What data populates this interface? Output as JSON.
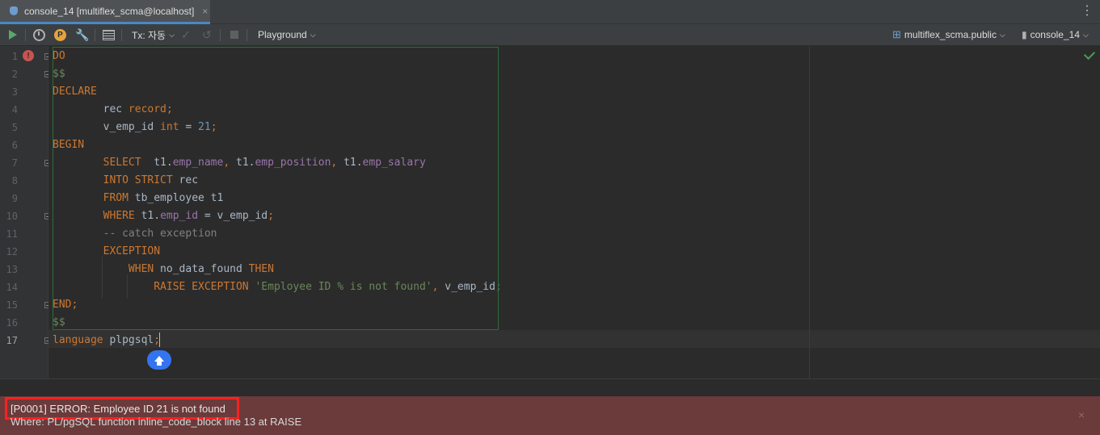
{
  "tab": {
    "title": "console_14 [multiflex_scma@localhost]",
    "close": "×"
  },
  "toolbar": {
    "tx_label": "Tx: 자동",
    "playground_label": "Playground",
    "schema_label": "multiflex_scma.public",
    "session_label": "console_14",
    "p_badge": "P"
  },
  "editor": {
    "lines": [
      {
        "n": "1",
        "tokens": [
          {
            "t": "DO",
            "c": "kw"
          }
        ]
      },
      {
        "n": "2",
        "tokens": [
          {
            "t": "$$",
            "c": "str"
          }
        ]
      },
      {
        "n": "3",
        "tokens": [
          {
            "t": "DECLARE",
            "c": "kw"
          }
        ]
      },
      {
        "n": "4",
        "tokens": [
          {
            "t": "        rec ",
            "c": "plain"
          },
          {
            "t": "record;",
            "c": "kw"
          }
        ]
      },
      {
        "n": "5",
        "tokens": [
          {
            "t": "        v_emp_id ",
            "c": "plain"
          },
          {
            "t": "int",
            "c": "kw"
          },
          {
            "t": " = ",
            "c": "plain"
          },
          {
            "t": "21",
            "c": "num"
          },
          {
            "t": ";",
            "c": "kw"
          }
        ]
      },
      {
        "n": "6",
        "tokens": [
          {
            "t": "BEGIN",
            "c": "kw"
          }
        ]
      },
      {
        "n": "7",
        "tokens": [
          {
            "t": "        SELECT",
            "c": "kw"
          },
          {
            "t": "  t1.",
            "c": "plain"
          },
          {
            "t": "emp_name",
            "c": "fld"
          },
          {
            "t": ", ",
            "c": "kw"
          },
          {
            "t": "t1.",
            "c": "plain"
          },
          {
            "t": "emp_position",
            "c": "fld"
          },
          {
            "t": ", ",
            "c": "kw"
          },
          {
            "t": "t1.",
            "c": "plain"
          },
          {
            "t": "emp_salary",
            "c": "fld"
          }
        ]
      },
      {
        "n": "8",
        "tokens": [
          {
            "t": "        INTO STRICT",
            "c": "kw"
          },
          {
            "t": " rec",
            "c": "plain"
          }
        ]
      },
      {
        "n": "9",
        "tokens": [
          {
            "t": "        FROM",
            "c": "kw"
          },
          {
            "t": " tb_employee t1",
            "c": "plain"
          }
        ]
      },
      {
        "n": "10",
        "tokens": [
          {
            "t": "        WHERE",
            "c": "kw"
          },
          {
            "t": " t1.",
            "c": "plain"
          },
          {
            "t": "emp_id",
            "c": "fld"
          },
          {
            "t": " = v_emp_id",
            "c": "plain"
          },
          {
            "t": ";",
            "c": "kw"
          }
        ]
      },
      {
        "n": "11",
        "tokens": [
          {
            "t": "        -- catch exception",
            "c": "cmt"
          }
        ]
      },
      {
        "n": "12",
        "tokens": [
          {
            "t": "        EXCEPTION",
            "c": "kw"
          }
        ]
      },
      {
        "n": "13",
        "tokens": [
          {
            "t": "            WHEN",
            "c": "kw"
          },
          {
            "t": " no_data_found ",
            "c": "plain"
          },
          {
            "t": "THEN",
            "c": "kw"
          }
        ]
      },
      {
        "n": "14",
        "tokens": [
          {
            "t": "                RAISE EXCEPTION",
            "c": "kw"
          },
          {
            "t": " ",
            "c": "plain"
          },
          {
            "t": "'Employee ID % is not found'",
            "c": "str"
          },
          {
            "t": ", ",
            "c": "kw"
          },
          {
            "t": "v_emp_id",
            "c": "plain"
          },
          {
            "t": ";",
            "c": "kw"
          }
        ]
      },
      {
        "n": "15",
        "tokens": [
          {
            "t": "END;",
            "c": "kw"
          }
        ]
      },
      {
        "n": "16",
        "tokens": [
          {
            "t": "$$",
            "c": "str"
          }
        ]
      },
      {
        "n": "17",
        "tokens": [
          {
            "t": "language",
            "c": "kw"
          },
          {
            "t": " plpgsql",
            "c": "plain"
          },
          {
            "t": ";",
            "c": "kw"
          }
        ]
      }
    ]
  },
  "error": {
    "message": "[P0001] ERROR: Employee ID 21 is not found",
    "where": "Where: PL/pgSQL function inline_code_block line 13 at RAISE",
    "close": "×"
  },
  "colors": {
    "error_panel": "#6b3a3a",
    "highlight": "#ff2020",
    "accent": "#3574f0"
  }
}
